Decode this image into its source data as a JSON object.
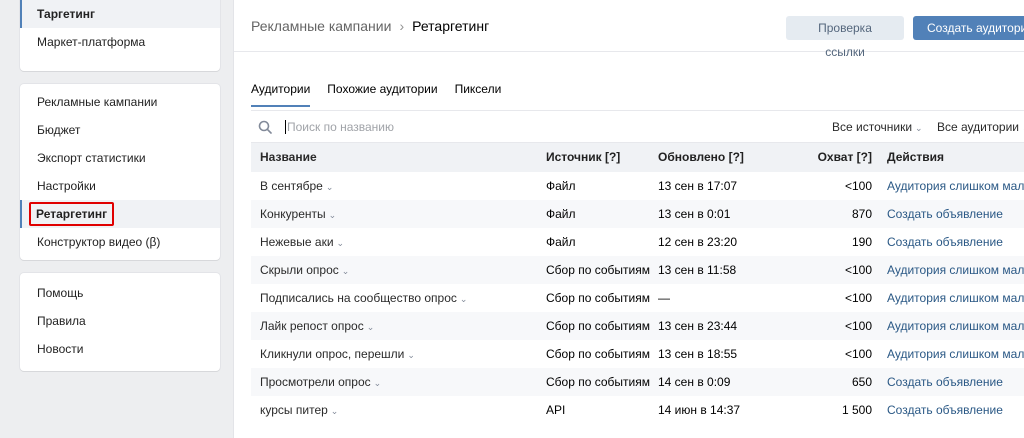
{
  "sidebar": {
    "block1": [
      {
        "label": "Таргетинг",
        "active": true
      },
      {
        "label": "Маркет-платформа"
      }
    ],
    "block2": [
      {
        "label": "Рекламные кампании"
      },
      {
        "label": "Бюджет"
      },
      {
        "label": "Экспорт статистики"
      },
      {
        "label": "Настройки"
      },
      {
        "label": "Ретаргетинг",
        "active": true,
        "highlighted": true
      },
      {
        "label": "Конструктор видео (β)"
      }
    ],
    "block3": [
      {
        "label": "Помощь"
      },
      {
        "label": "Правила"
      },
      {
        "label": "Новости"
      }
    ]
  },
  "header": {
    "breadcrumb_parent": "Рекламные кампании",
    "breadcrumb_separator": "›",
    "breadcrumb_current": "Ретаргетинг",
    "check_link_button": "Проверка ссылки",
    "create_audience_button": "Создать аудиторию"
  },
  "tabs": [
    {
      "label": "Аудитории",
      "active": true
    },
    {
      "label": "Похожие аудитории"
    },
    {
      "label": "Пиксели"
    }
  ],
  "search": {
    "placeholder": "Поиск по названию",
    "value": ""
  },
  "filters": {
    "sources": "Все источники",
    "audiences": "Все аудитории"
  },
  "table": {
    "columns": [
      "Название",
      "Источник [?]",
      "Обновлено [?]",
      "Охват [?]",
      "Действия"
    ],
    "rows": [
      {
        "name": "В сентябре",
        "source": "Файл",
        "updated": "13 сен в 17:07",
        "reach": "<100",
        "action": "Аудитория слишком мала"
      },
      {
        "name": "Конкуренты",
        "source": "Файл",
        "updated": "13 сен в 0:01",
        "reach": "870",
        "action": "Создать объявление"
      },
      {
        "name": "Нежевые аки",
        "source": "Файл",
        "updated": "12 сен в 23:20",
        "reach": "190",
        "action": "Создать объявление"
      },
      {
        "name": "Скрыли опрос",
        "source": "Сбор по событиям",
        "updated": "13 сен в 11:58",
        "reach": "<100",
        "action": "Аудитория слишком мала"
      },
      {
        "name": "Подписались на сообщество опрос",
        "source": "Сбор по событиям",
        "updated": "—",
        "reach": "<100",
        "action": "Аудитория слишком мала"
      },
      {
        "name": "Лайк репост опрос",
        "source": "Сбор по событиям",
        "updated": "13 сен в 23:44",
        "reach": "<100",
        "action": "Аудитория слишком мала"
      },
      {
        "name": "Кликнули опрос, перешли",
        "source": "Сбор по событиям",
        "updated": "13 сен в 18:55",
        "reach": "<100",
        "action": "Аудитория слишком мала"
      },
      {
        "name": "Просмотрели опрос",
        "source": "Сбор по событиям",
        "updated": "14 сен в 0:09",
        "reach": "650",
        "action": "Создать объявление"
      },
      {
        "name": "курсы питер",
        "source": "API",
        "updated": "14 июн в 14:37",
        "reach": "1 500",
        "action": "Создать объявление"
      }
    ]
  },
  "icons": {
    "search": "search-icon",
    "chevron": "chevron-down-icon"
  },
  "colors": {
    "accent": "#5181b8",
    "link": "#2a5885",
    "highlight_box": "#e00000"
  }
}
